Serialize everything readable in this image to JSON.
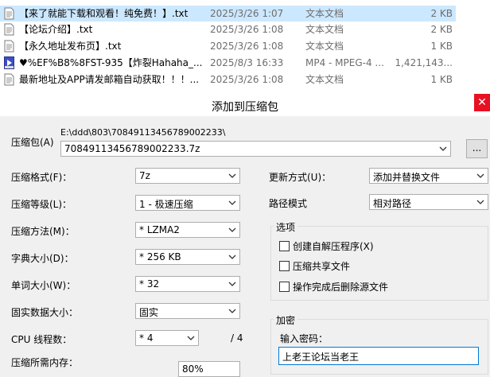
{
  "files": [
    {
      "name": "【来了就能下载和观看！纯免费！】.txt",
      "date": "2025/3/26 1:07",
      "type": "文本文档",
      "size": "2 KB",
      "icon": "text-file-icon"
    },
    {
      "name": "【论坛介绍】.txt",
      "date": "2025/3/26 1:08",
      "type": "文本文档",
      "size": "2 KB",
      "icon": "text-file-icon"
    },
    {
      "name": "【永久地址发布页】.txt",
      "date": "2025/3/26 1:08",
      "type": "文本文档",
      "size": "1 KB",
      "icon": "text-file-icon"
    },
    {
      "name": "♥%EF%B8%8FST-935【炸裂Hahaha_...",
      "date": "2025/8/3 16:33",
      "type": "MP4 - MPEG-4 ...",
      "size": "1,421,143...",
      "icon": "video-file-icon"
    },
    {
      "name": "最新地址及APP请发邮箱自动获取！！！...",
      "date": "2025/3/26 1:08",
      "type": "文本文档",
      "size": "1 KB",
      "icon": "text-file-icon"
    }
  ],
  "dialog": {
    "title": "添加到压缩包",
    "archive_label": "压缩包(A)",
    "archive_path": "E:\\ddd\\803\\70849113456789002233\\",
    "archive_name": "70849113456789002233.7z",
    "browse_label": "...",
    "format_label": "压缩格式(F)：",
    "format_value": "7z",
    "level_label": "压缩等级(L)：",
    "level_value": "1 - 极速压缩",
    "method_label": "压缩方法(M)：",
    "method_value": "* LZMA2",
    "dict_label": "字典大小(D)：",
    "dict_value": "* 256 KB",
    "word_label": "单词大小(W)：",
    "word_value": "* 32",
    "solid_label": "固实数据大小：",
    "solid_value": "固实",
    "cpu_label": "CPU 线程数：",
    "cpu_value": "* 4",
    "cpu_total": "/ 4",
    "mem_label": "压缩所需内存：",
    "mem_value": "80%",
    "update_label": "更新方式(U)：",
    "update_value": "添加并替换文件",
    "path_label": "路径模式",
    "path_value": "相对路径",
    "options_label": "选项",
    "opt_sfx": "创建自解压程序(X)",
    "opt_shared": "压缩共享文件",
    "opt_delete": "操作完成后删除源文件",
    "encrypt_label": "加密",
    "password_label": "输入密码：",
    "password_value": "上老王论坛当老王"
  }
}
